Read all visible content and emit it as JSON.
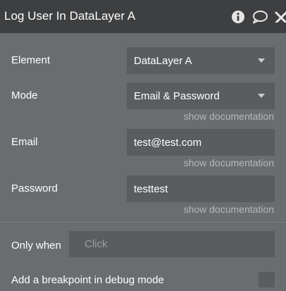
{
  "header": {
    "title": "Log User In DataLayer A"
  },
  "form": {
    "element": {
      "label": "Element",
      "value": "DataLayer A"
    },
    "mode": {
      "label": "Mode",
      "value": "Email & Password",
      "docs": "show documentation"
    },
    "email": {
      "label": "Email",
      "value": "test@test.com",
      "docs": "show documentation"
    },
    "password": {
      "label": "Password",
      "value": "testtest",
      "docs": "show documentation"
    }
  },
  "only_when": {
    "label": "Only when",
    "placeholder": "Click"
  },
  "breakpoint": {
    "label": "Add a breakpoint in debug mode",
    "checked": false
  },
  "icons": [
    "info-icon",
    "comment-icon",
    "close-icon"
  ],
  "colors": {
    "header_bg": "#3d3f41",
    "panel_bg": "#6a6d70",
    "field_bg": "#5a5d60",
    "doc_text": "#b4b7ba"
  }
}
